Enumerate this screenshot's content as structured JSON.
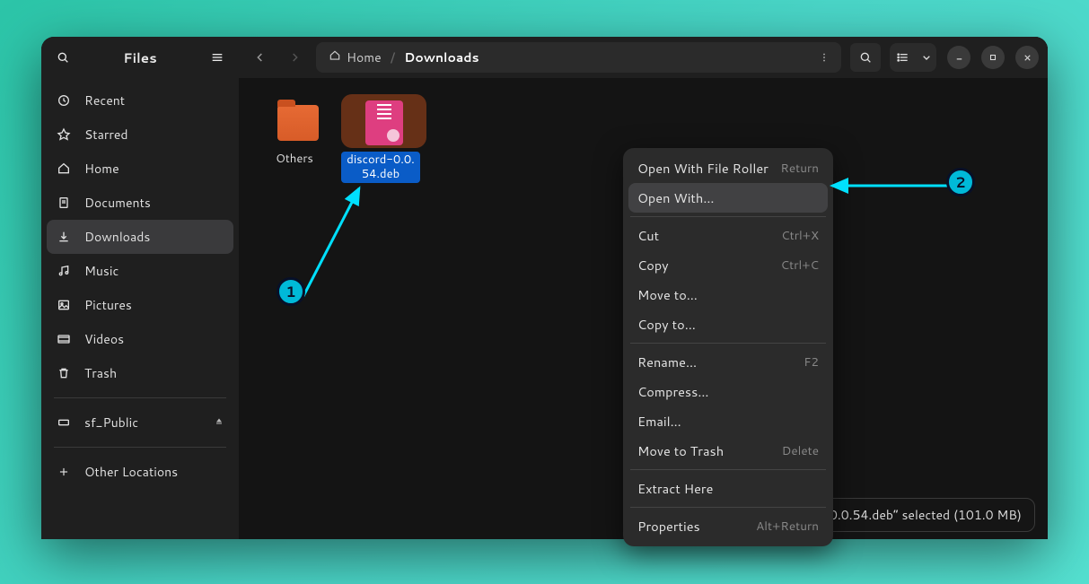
{
  "sidebar": {
    "title": "Files",
    "items": [
      {
        "label": "Recent"
      },
      {
        "label": "Starred"
      },
      {
        "label": "Home"
      },
      {
        "label": "Documents"
      },
      {
        "label": "Downloads"
      },
      {
        "label": "Music"
      },
      {
        "label": "Pictures"
      },
      {
        "label": "Videos"
      },
      {
        "label": "Trash"
      }
    ],
    "mount": {
      "label": "sf_Public"
    },
    "other": {
      "label": "Other Locations"
    }
  },
  "breadcrumb": {
    "home": "Home",
    "current": "Downloads"
  },
  "files": {
    "folder": "Others",
    "selected": "discord-0.0.54.deb",
    "selected_display_line1": "discord-0.0.",
    "selected_display_line2": "54.deb"
  },
  "menu": {
    "open_default": "Open With File Roller",
    "open_default_accel": "Return",
    "open_with": "Open With…",
    "cut": "Cut",
    "cut_accel": "Ctrl+X",
    "copy": "Copy",
    "copy_accel": "Ctrl+C",
    "move_to": "Move to…",
    "copy_to": "Copy to…",
    "rename": "Rename…",
    "rename_accel": "F2",
    "compress": "Compress…",
    "email": "Email…",
    "trash": "Move to Trash",
    "trash_accel": "Delete",
    "extract": "Extract Here",
    "properties": "Properties",
    "properties_accel": "Alt+Return"
  },
  "status": "“discord-0.0.54.deb” selected  (101.0 MB)",
  "callouts": {
    "one": "1",
    "two": "2"
  }
}
